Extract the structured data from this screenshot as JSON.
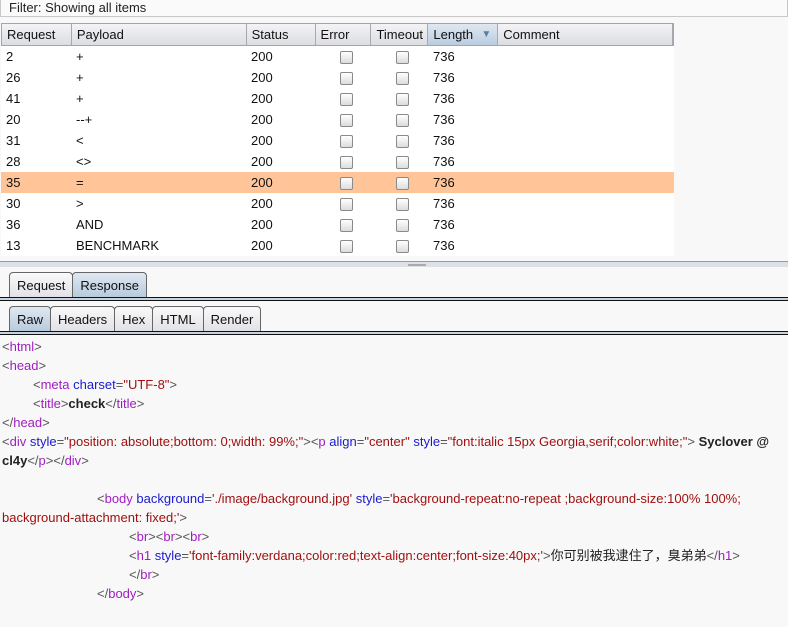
{
  "filter": "Filter: Showing all items",
  "table": {
    "columns": [
      {
        "label": "Request",
        "w": 70
      },
      {
        "label": "Payload",
        "w": 175
      },
      {
        "label": "Status",
        "w": 69
      },
      {
        "label": "Error",
        "w": 56
      },
      {
        "label": "Timeout",
        "w": 57
      },
      {
        "label": "Length",
        "w": 70,
        "sorted": "descending"
      },
      {
        "label": "Comment",
        "w": 175
      }
    ],
    "rows": [
      {
        "request": "2",
        "payload": "+",
        "status": "200",
        "error": false,
        "timeout": false,
        "length": "736",
        "comment": ""
      },
      {
        "request": "26",
        "payload": "+",
        "status": "200",
        "error": false,
        "timeout": false,
        "length": "736",
        "comment": ""
      },
      {
        "request": "41",
        "payload": "+",
        "status": "200",
        "error": false,
        "timeout": false,
        "length": "736",
        "comment": ""
      },
      {
        "request": "20",
        "payload": "--+",
        "status": "200",
        "error": false,
        "timeout": false,
        "length": "736",
        "comment": ""
      },
      {
        "request": "31",
        "payload": "<",
        "status": "200",
        "error": false,
        "timeout": false,
        "length": "736",
        "comment": ""
      },
      {
        "request": "28",
        "payload": "<>",
        "status": "200",
        "error": false,
        "timeout": false,
        "length": "736",
        "comment": ""
      },
      {
        "request": "35",
        "payload": "=",
        "status": "200",
        "error": false,
        "timeout": false,
        "length": "736",
        "comment": "",
        "selected": true
      },
      {
        "request": "30",
        "payload": ">",
        "status": "200",
        "error": false,
        "timeout": false,
        "length": "736",
        "comment": ""
      },
      {
        "request": "36",
        "payload": "AND",
        "status": "200",
        "error": false,
        "timeout": false,
        "length": "736",
        "comment": ""
      },
      {
        "request": "13",
        "payload": "BENCHMARK",
        "status": "200",
        "error": false,
        "timeout": false,
        "length": "736",
        "comment": ""
      }
    ],
    "selected_color": "#ffc599"
  },
  "message_tabs": [
    "Request",
    "Response"
  ],
  "message_tab_active": 1,
  "view_tabs": [
    "Raw",
    "Headers",
    "Hex",
    "HTML",
    "Render"
  ],
  "view_tab_active": 0,
  "code": {
    "lines": [
      {
        "indent": 0,
        "tokens": [
          [
            "p",
            "<"
          ],
          [
            "t",
            "html"
          ],
          [
            "p",
            ">"
          ]
        ]
      },
      {
        "indent": 0,
        "tokens": [
          [
            "p",
            "<"
          ],
          [
            "t",
            "head"
          ],
          [
            "p",
            ">"
          ]
        ]
      },
      {
        "indent": 31,
        "tokens": [
          [
            "p",
            "<"
          ],
          [
            "t",
            "meta"
          ],
          [
            "n",
            " "
          ],
          [
            "a",
            "charset"
          ],
          [
            "p",
            "="
          ],
          [
            "v",
            "\"UTF-8\""
          ],
          [
            "p",
            ">"
          ]
        ]
      },
      {
        "indent": 31,
        "tokens": [
          [
            "p",
            "<"
          ],
          [
            "t",
            "title"
          ],
          [
            "p",
            ">"
          ],
          [
            "x",
            "check"
          ],
          [
            "p",
            "</"
          ],
          [
            "t",
            "title"
          ],
          [
            "p",
            ">"
          ]
        ]
      },
      {
        "indent": 0,
        "tokens": [
          [
            "p",
            "</"
          ],
          [
            "t",
            "head"
          ],
          [
            "p",
            ">"
          ]
        ]
      },
      {
        "indent": 0,
        "tokens": [
          [
            "p",
            "<"
          ],
          [
            "t",
            "div"
          ],
          [
            "n",
            " "
          ],
          [
            "a",
            "style"
          ],
          [
            "p",
            "="
          ],
          [
            "v",
            "\"position: absolute;bottom: 0;width: 99%;\""
          ],
          [
            "p",
            ">"
          ],
          [
            "p",
            "<"
          ],
          [
            "t",
            "p"
          ],
          [
            "n",
            " "
          ],
          [
            "a",
            "align"
          ],
          [
            "p",
            "="
          ],
          [
            "v",
            "\"center\""
          ],
          [
            "n",
            " "
          ],
          [
            "a",
            "style"
          ],
          [
            "p",
            "="
          ],
          [
            "v",
            "\"font:italic 15px Georgia,serif;color:white;\""
          ],
          [
            "p",
            ">"
          ],
          [
            "x",
            " Syclover @"
          ]
        ]
      },
      {
        "indent": 0,
        "tokens": [
          [
            "x",
            "cl4y"
          ],
          [
            "p",
            "</"
          ],
          [
            "t",
            "p"
          ],
          [
            "p",
            "></"
          ],
          [
            "t",
            "div"
          ],
          [
            "p",
            ">"
          ]
        ]
      },
      {
        "indent": 0,
        "tokens": []
      },
      {
        "indent": 95,
        "tokens": [
          [
            "p",
            "<"
          ],
          [
            "t",
            "body"
          ],
          [
            "n",
            " "
          ],
          [
            "a",
            "background"
          ],
          [
            "p",
            "="
          ],
          [
            "v",
            "'./image/background.jpg'"
          ],
          [
            "n",
            " "
          ],
          [
            "a",
            "style"
          ],
          [
            "p",
            "="
          ],
          [
            "v",
            "'background-repeat:no-repeat ;background-size:100% 100%;"
          ]
        ]
      },
      {
        "indent": 0,
        "tokens": [
          [
            "v",
            "background-attachment: fixed;'"
          ],
          [
            "p",
            ">"
          ]
        ]
      },
      {
        "indent": 127,
        "tokens": [
          [
            "p",
            "<"
          ],
          [
            "t",
            "br"
          ],
          [
            "p",
            "><"
          ],
          [
            "t",
            "br"
          ],
          [
            "p",
            "><"
          ],
          [
            "t",
            "br"
          ],
          [
            "p",
            ">"
          ]
        ]
      },
      {
        "indent": 127,
        "tokens": [
          [
            "p",
            "<"
          ],
          [
            "t",
            "h1"
          ],
          [
            "n",
            " "
          ],
          [
            "a",
            "style"
          ],
          [
            "p",
            "="
          ],
          [
            "v",
            "'font-family:verdana;color:red;text-align:center;font-size:40px;'"
          ],
          [
            "p",
            ">"
          ],
          [
            "n",
            "你可别被我逮住了，臭弟弟"
          ],
          [
            "p",
            "</"
          ],
          [
            "t",
            "h1"
          ],
          [
            "p",
            ">"
          ]
        ]
      },
      {
        "indent": 127,
        "tokens": [
          [
            "p",
            "</"
          ],
          [
            "t",
            "br"
          ],
          [
            "p",
            ">"
          ]
        ]
      },
      {
        "indent": 95,
        "tokens": [
          [
            "p",
            "</"
          ],
          [
            "t",
            "body"
          ],
          [
            "p",
            ">"
          ]
        ]
      }
    ]
  }
}
